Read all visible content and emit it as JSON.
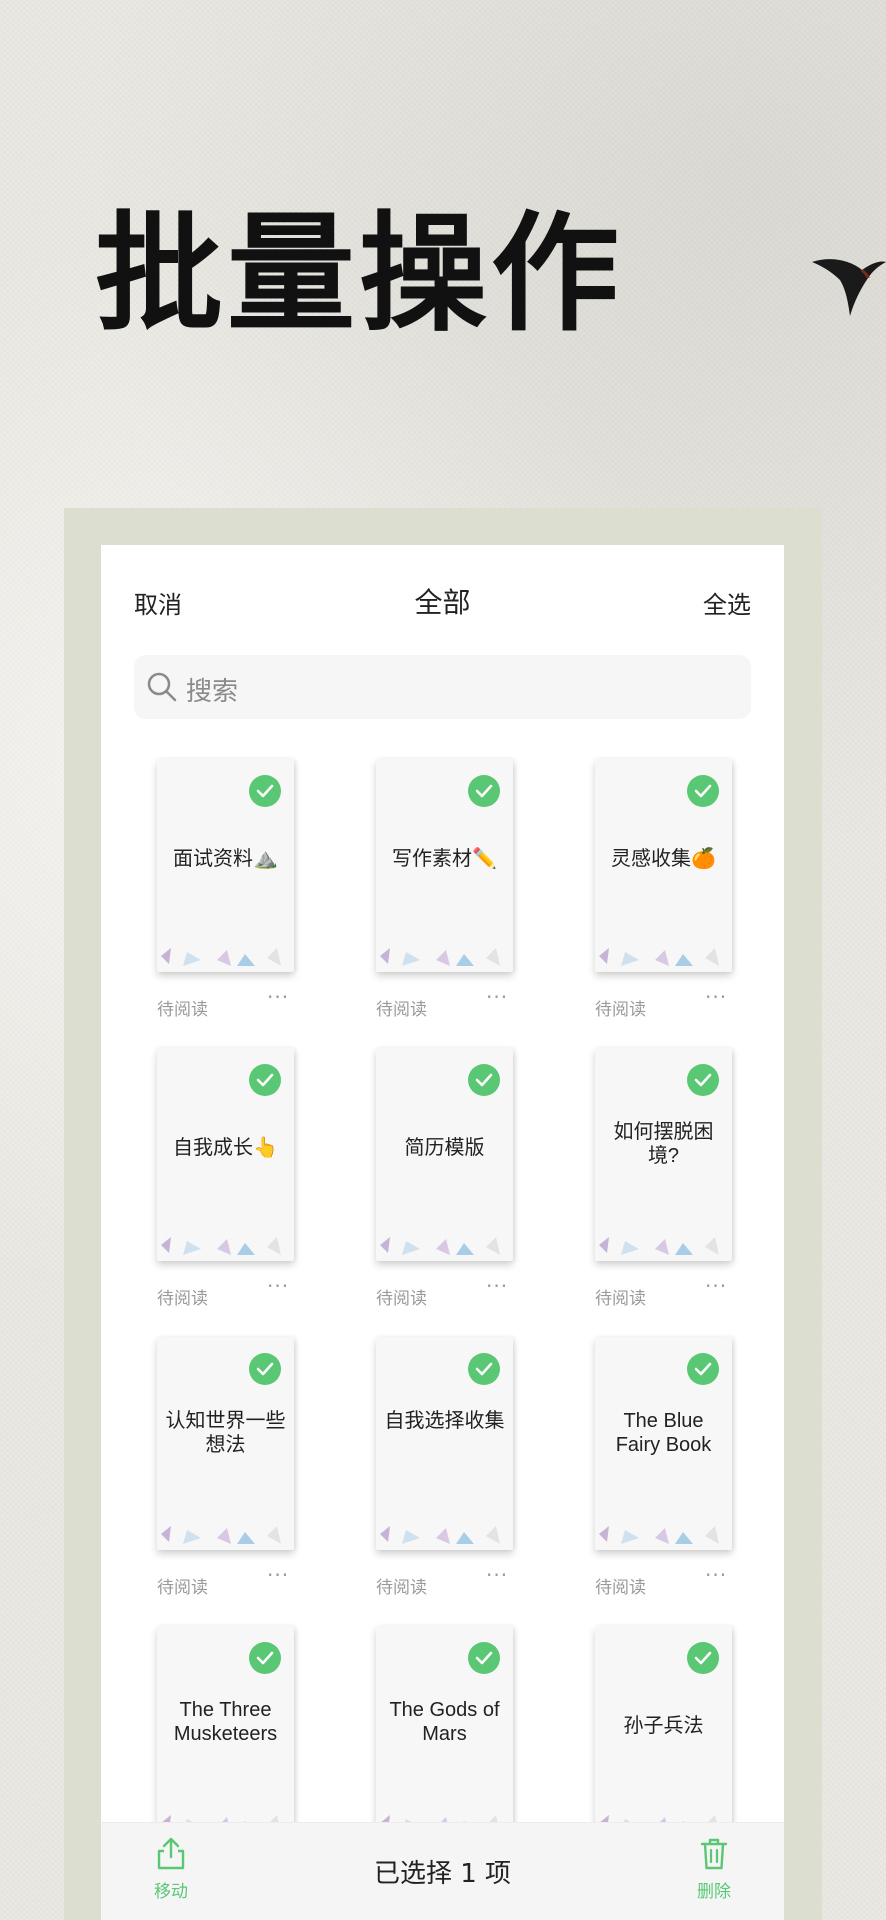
{
  "headline": "批量操作",
  "topbar": {
    "cancel": "取消",
    "title": "全部",
    "select_all": "全选"
  },
  "search": {
    "placeholder": "搜索"
  },
  "books": [
    {
      "title": "面试资料⛰️",
      "status": "待阅读",
      "more": "···",
      "selected": true
    },
    {
      "title": "写作素材✏️",
      "status": "待阅读",
      "more": "···",
      "selected": true
    },
    {
      "title": "灵感收集🍊",
      "status": "待阅读",
      "more": "···",
      "selected": true
    },
    {
      "title": "自我成长👆",
      "status": "待阅读",
      "more": "···",
      "selected": true
    },
    {
      "title": "简历模版",
      "status": "待阅读",
      "more": "···",
      "selected": true
    },
    {
      "title": "如何摆脱困境?",
      "status": "待阅读",
      "more": "···",
      "selected": true
    },
    {
      "title": "认知世界一些想法",
      "status": "待阅读",
      "more": "···",
      "selected": true
    },
    {
      "title": "自我选择收集",
      "status": "待阅读",
      "more": "···",
      "selected": true
    },
    {
      "title": "The Blue Fairy Book",
      "status": "待阅读",
      "more": "···",
      "selected": true
    },
    {
      "title": "The Three Musketeers",
      "status": "",
      "more": "",
      "selected": true
    },
    {
      "title": "The Gods of Mars",
      "status": "",
      "more": "",
      "selected": true
    },
    {
      "title": "孙子兵法",
      "status": "",
      "more": "",
      "selected": true
    }
  ],
  "bottombar": {
    "move_label": "移动",
    "selection": "已选择 1 项",
    "delete_label": "删除"
  },
  "colors": {
    "accent": "#5ac774",
    "background": "#ebe9e2",
    "frame": "#dcdfcf"
  }
}
